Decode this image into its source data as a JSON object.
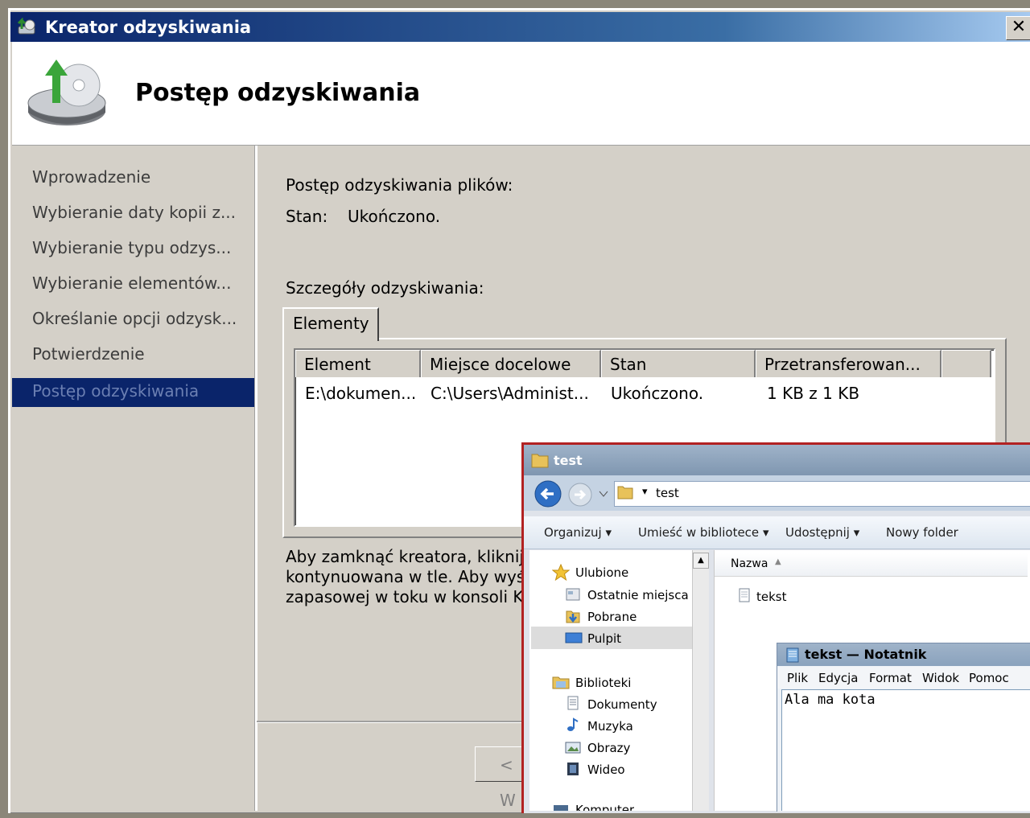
{
  "wizard": {
    "title": "Kreator odzyskiwania",
    "close_glyph": "✕",
    "header_title": "Postęp odzyskiwania",
    "nav_items": [
      "Wprowadzenie",
      "Wybieranie daty kopii z...",
      "Wybieranie typu odzys...",
      "Wybieranie elementów...",
      "Określanie opcji odzysk...",
      "Potwierdzenie"
    ],
    "nav_active": "Postęp odzyskiwania",
    "progress_label": "Postęp odzyskiwania plików:",
    "status_label": "Stan:",
    "status_value": "Ukończono.",
    "details_label": "Szczegóły odzyskiwania:",
    "tab_label": "Elementy",
    "columns": [
      "Element",
      "Miejsce docelowe",
      "Stan",
      "Przetransferowan..."
    ],
    "rows": [
      {
        "element": "E:\\dokumen...",
        "destination": "C:\\Users\\Administ...",
        "status": "Ukończono.",
        "transferred": "1 KB z 1 KB"
      }
    ],
    "note_lines": [
      "Aby zamknąć kreatora, kliknij p",
      "kontynuowana w tle. Aby wyś",
      "zapasowej w toku w konsoli Ko"
    ],
    "back_button": "< W"
  },
  "explorer": {
    "title": "test",
    "address": "test",
    "commands": [
      "Organizuj",
      "Umieść w bibliotece",
      "Udostępnij",
      "Nowy folder"
    ],
    "favorites_header": "Ulubione",
    "favorites": [
      "Ostatnie miejsca",
      "Pobrane",
      "Pulpit"
    ],
    "libraries_header": "Biblioteki",
    "libraries": [
      "Dokumenty",
      "Muzyka",
      "Obrazy",
      "Wideo"
    ],
    "column_name": "Nazwa",
    "files": [
      "tekst"
    ],
    "cut_off_item": "Komputer"
  },
  "notepad": {
    "title": "tekst — Notatnik",
    "menu": [
      "Plik",
      "Edycja",
      "Format",
      "Widok",
      "Pomoc"
    ],
    "content": "Ala ma kota"
  },
  "colors": {
    "titlebar": "#0a246a",
    "dialog_bg": "#d4d0c8",
    "active_nav": "#0a246a",
    "explorer_border": "#b22222"
  }
}
